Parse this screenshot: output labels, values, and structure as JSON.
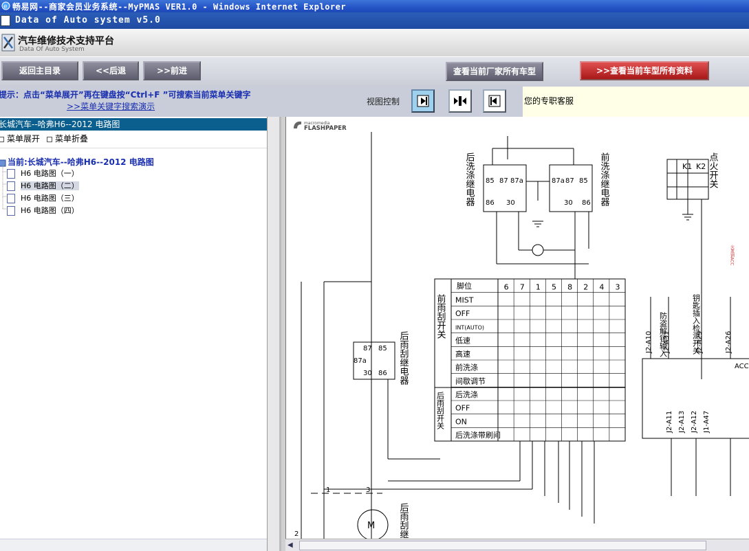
{
  "window": {
    "title": "畅易网--商家会员业务系统--MyPMAS VER1.0 - Windows Internet Explorer"
  },
  "app": {
    "strip_title": "Data of Auto system v5.0"
  },
  "header": {
    "title": "汽车维修技术支持平台",
    "subtitle": "Data Of Auto System"
  },
  "toolbar": {
    "home": "返回主目录",
    "back": "<<后退",
    "forward": ">>前进",
    "all_models": "查看当前厂家所有车型",
    "all_data": ">>查看当前车型所有资料"
  },
  "hint": {
    "text": "提示：点击“菜单展开”再在键盘按“Ctrl+F ”可搜索当前菜单关键字",
    "link": ">>菜单关键字搜索演示",
    "view_label": "视图控制",
    "service": "您的专职客服"
  },
  "tree": {
    "breadcrumb": "长城汽车--哈弗H6--2012 电路图",
    "expand": "菜单展开",
    "collapse": "菜单折叠",
    "root": "当前:长城汽车--哈弗H6--2012 电路图",
    "items": [
      {
        "label": "H6 电路图（一）"
      },
      {
        "label": "H6 电路图（二）"
      },
      {
        "label": "H6 电路图（三）"
      },
      {
        "label": "H6 电路图（四）"
      }
    ]
  },
  "viewer": {
    "brand_top": "macromedia",
    "brand_main": "FLASHPAPER",
    "diagram": {
      "rear_relay": "后洗涤继电器",
      "front_relay": "前洗涤继电器",
      "rear_wiper_relay": "后雨刮继电器",
      "ign_switch": "点火开关",
      "anti_theft": "防盗解锁输入",
      "key_in": "钥匙插入检测开关",
      "acc_hand": "火发钥ACC",
      "k1": "K1",
      "k2": "K2",
      "pos_label": "脚位",
      "cols": [
        "6",
        "7",
        "1",
        "5",
        "8",
        "2",
        "4",
        "3"
      ],
      "front_switch": "前雨刮开关",
      "rear_switch": "后雨刮开关",
      "rows": [
        "MIST",
        "OFF",
        "INT(AUTO)",
        "低速",
        "高速",
        "前洗涤",
        "间歇调节",
        "后洗涤",
        "OFF",
        "ON",
        "后洗涤带刷间"
      ],
      "pins": [
        "J2-A10",
        "J2-A31",
        "J2-A29",
        "J2-A26",
        "J2-A11",
        "J2-A13",
        "J2-A12",
        "J1-A47"
      ],
      "acc": "ACC",
      "relay_pins": [
        "85",
        "87",
        "87a",
        "30",
        "86"
      ]
    }
  }
}
